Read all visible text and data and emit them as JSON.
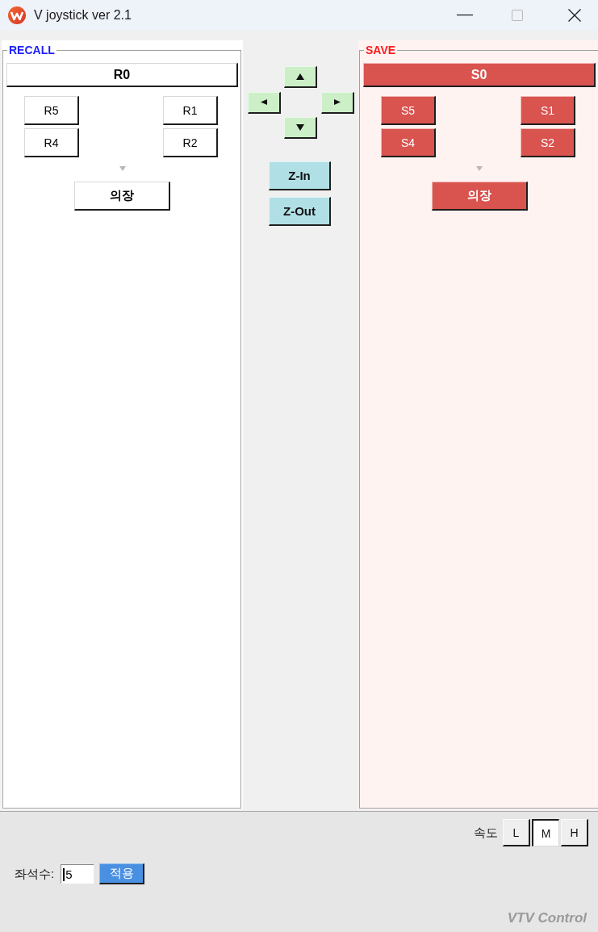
{
  "window": {
    "title": "V joystick ver 2.1",
    "controls": [
      {
        "kind": "minimize",
        "disabled": false
      },
      {
        "kind": "maximize",
        "disabled": true
      },
      {
        "kind": "close",
        "disabled": false
      }
    ]
  },
  "groups": [
    {
      "kind": "recall",
      "legend": "RECALL",
      "main": "R0",
      "presets": [
        {
          "label": "R5"
        },
        {
          "label": "R1"
        },
        {
          "label": "R4"
        },
        {
          "label": "R2"
        }
      ],
      "extra": "의장"
    },
    {
      "kind": "save",
      "legend": "SAVE",
      "main": "S0",
      "presets": [
        {
          "label": "S5"
        },
        {
          "label": "S1"
        },
        {
          "label": "S4"
        },
        {
          "label": "S2"
        }
      ],
      "extra": "의장"
    }
  ],
  "pad": {
    "directions": [
      {
        "kind": "up"
      },
      {
        "kind": "left"
      },
      {
        "kind": "right"
      },
      {
        "kind": "down"
      }
    ],
    "zoom": [
      "Z-In",
      "Z-Out"
    ]
  },
  "speed": {
    "label": "속도",
    "options": [
      {
        "label": "L",
        "selected": false
      },
      {
        "label": "M",
        "selected": true
      },
      {
        "label": "H",
        "selected": false
      }
    ]
  },
  "seats": {
    "label": "좌석수:",
    "value": "5",
    "button": "적용"
  },
  "footer": "VTV Control"
}
